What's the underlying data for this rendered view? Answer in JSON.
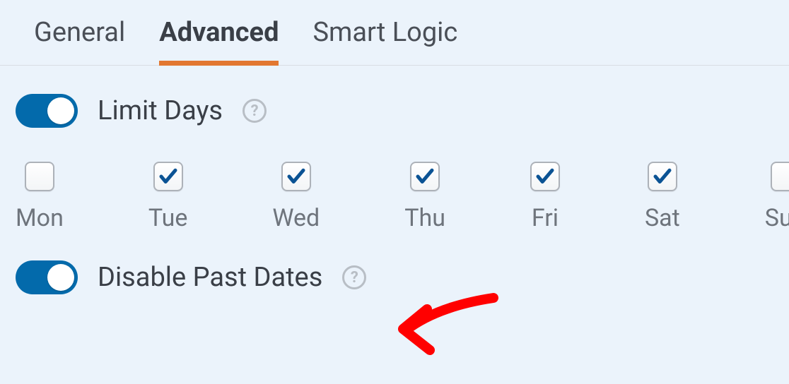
{
  "tabs": {
    "general": "General",
    "advanced": "Advanced",
    "smart_logic": "Smart Logic",
    "active": "advanced"
  },
  "limit_days": {
    "label": "Limit Days",
    "enabled": true
  },
  "days": [
    {
      "label": "Mon",
      "checked": false
    },
    {
      "label": "Tue",
      "checked": true
    },
    {
      "label": "Wed",
      "checked": true
    },
    {
      "label": "Thu",
      "checked": true
    },
    {
      "label": "Fri",
      "checked": true
    },
    {
      "label": "Sat",
      "checked": true
    },
    {
      "label": "Sun",
      "checked": false
    }
  ],
  "disable_past_dates": {
    "label": "Disable Past Dates",
    "enabled": true
  },
  "colors": {
    "accent_orange": "#e27730",
    "toggle_blue": "#036aab",
    "check_blue": "#0b5394",
    "annotation_red": "#ff0000"
  }
}
